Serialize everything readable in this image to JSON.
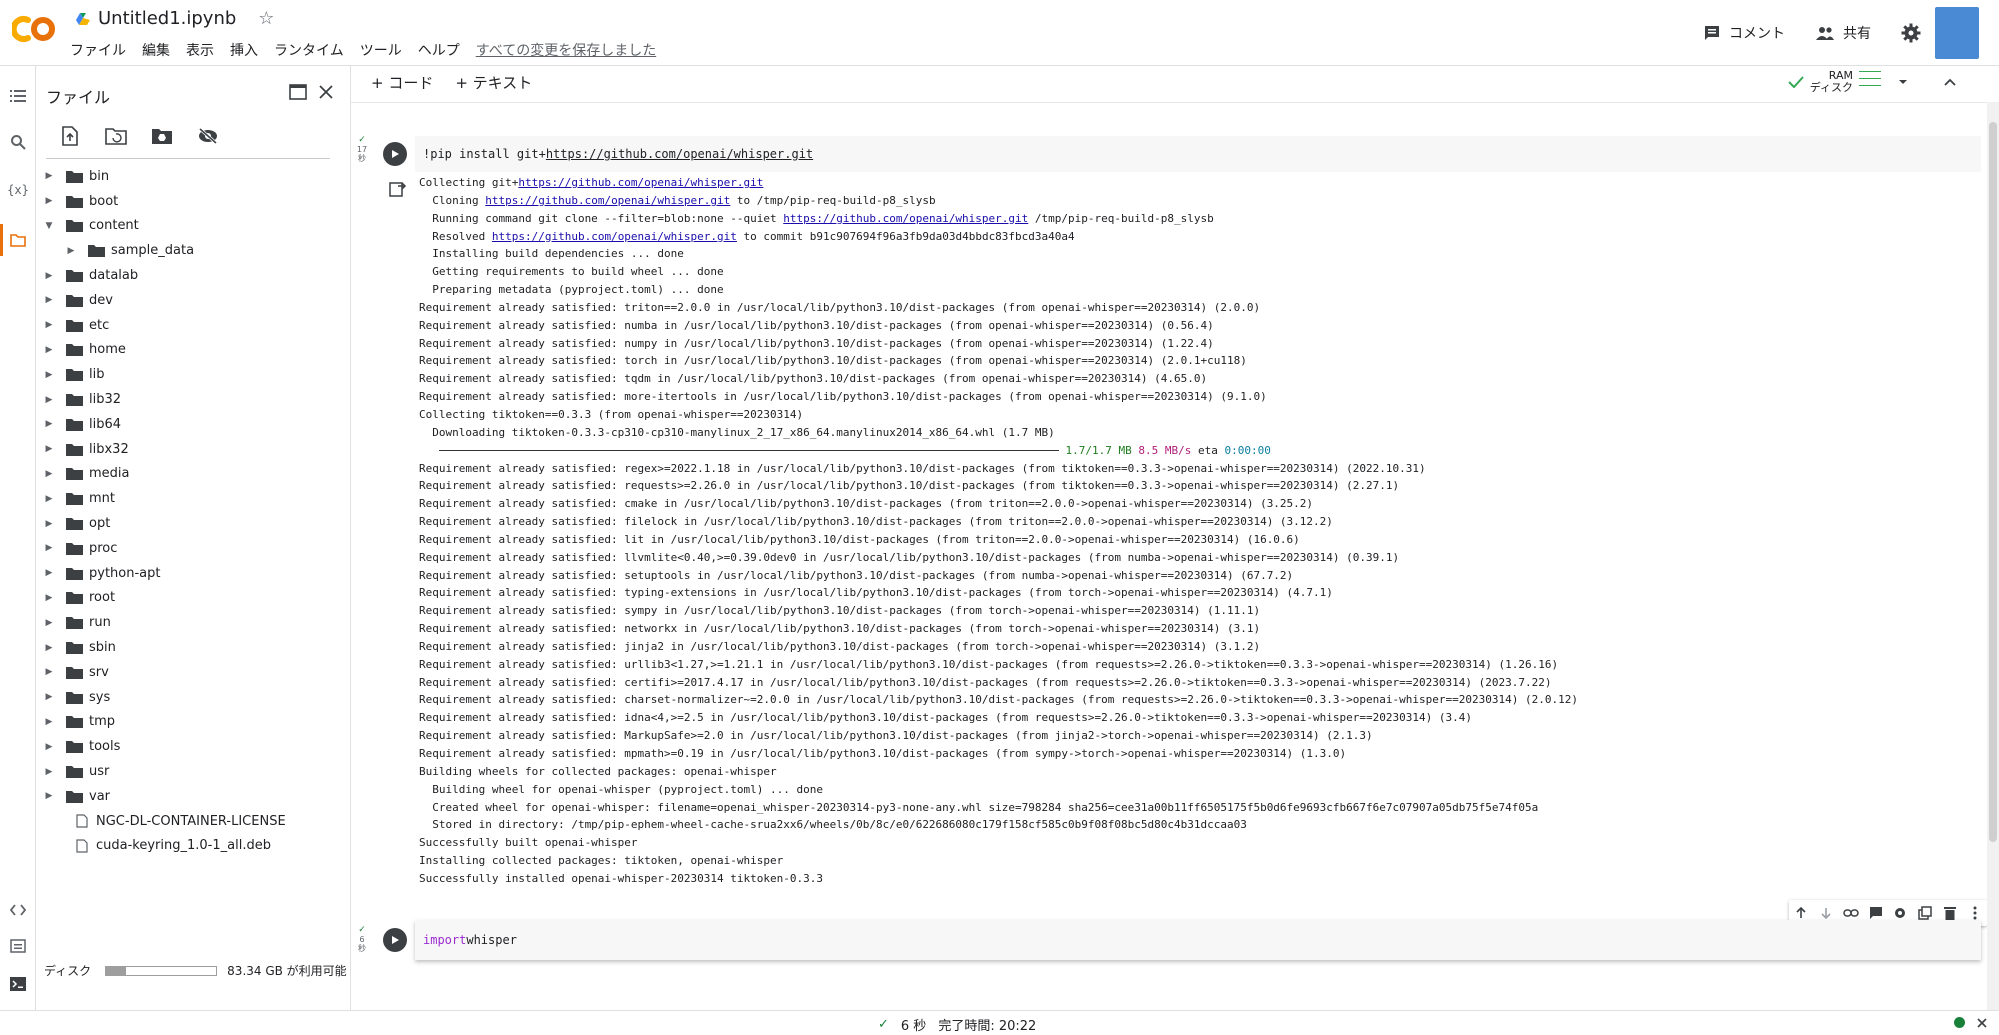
{
  "header": {
    "logo": "CO",
    "notebook_title": "Untitled1.ipynb",
    "star_glyph": "☆",
    "menu": [
      "ファイル",
      "編集",
      "表示",
      "挿入",
      "ランタイム",
      "ツール",
      "ヘルプ"
    ],
    "saved_status": "すべての変更を保存しました",
    "comment_label": "コメント",
    "share_label": "共有"
  },
  "file_panel": {
    "title": "ファイル",
    "tree": [
      {
        "label": "bin",
        "type": "folder",
        "depth": 0,
        "expanded": false
      },
      {
        "label": "boot",
        "type": "folder",
        "depth": 0,
        "expanded": false
      },
      {
        "label": "content",
        "type": "folder",
        "depth": 0,
        "expanded": true
      },
      {
        "label": "sample_data",
        "type": "folder",
        "depth": 1,
        "expanded": false
      },
      {
        "label": "datalab",
        "type": "folder",
        "depth": 0,
        "expanded": false
      },
      {
        "label": "dev",
        "type": "folder",
        "depth": 0,
        "expanded": false
      },
      {
        "label": "etc",
        "type": "folder",
        "depth": 0,
        "expanded": false
      },
      {
        "label": "home",
        "type": "folder",
        "depth": 0,
        "expanded": false
      },
      {
        "label": "lib",
        "type": "folder",
        "depth": 0,
        "expanded": false
      },
      {
        "label": "lib32",
        "type": "folder",
        "depth": 0,
        "expanded": false
      },
      {
        "label": "lib64",
        "type": "folder",
        "depth": 0,
        "expanded": false
      },
      {
        "label": "libx32",
        "type": "folder",
        "depth": 0,
        "expanded": false
      },
      {
        "label": "media",
        "type": "folder",
        "depth": 0,
        "expanded": false
      },
      {
        "label": "mnt",
        "type": "folder",
        "depth": 0,
        "expanded": false
      },
      {
        "label": "opt",
        "type": "folder",
        "depth": 0,
        "expanded": false
      },
      {
        "label": "proc",
        "type": "folder",
        "depth": 0,
        "expanded": false
      },
      {
        "label": "python-apt",
        "type": "folder",
        "depth": 0,
        "expanded": false
      },
      {
        "label": "root",
        "type": "folder",
        "depth": 0,
        "expanded": false
      },
      {
        "label": "run",
        "type": "folder",
        "depth": 0,
        "expanded": false
      },
      {
        "label": "sbin",
        "type": "folder",
        "depth": 0,
        "expanded": false
      },
      {
        "label": "srv",
        "type": "folder",
        "depth": 0,
        "expanded": false
      },
      {
        "label": "sys",
        "type": "folder",
        "depth": 0,
        "expanded": false
      },
      {
        "label": "tmp",
        "type": "folder",
        "depth": 0,
        "expanded": false
      },
      {
        "label": "tools",
        "type": "folder",
        "depth": 0,
        "expanded": false
      },
      {
        "label": "usr",
        "type": "folder",
        "depth": 0,
        "expanded": false
      },
      {
        "label": "var",
        "type": "folder",
        "depth": 0,
        "expanded": false
      },
      {
        "label": "NGC-DL-CONTAINER-LICENSE",
        "type": "file",
        "depth": 0
      },
      {
        "label": "cuda-keyring_1.0-1_all.deb",
        "type": "file",
        "depth": 0
      }
    ],
    "disk_label": "ディスク",
    "disk_usage_fraction": 0.18,
    "disk_free": "83.34 GB が利用可能"
  },
  "toolbar": {
    "add_code": "+ コード",
    "add_text": "+ テキスト",
    "ram_label": "RAM",
    "disk_label": "ディスク"
  },
  "cell1": {
    "exec_check": "✓",
    "exec_time": "17",
    "exec_unit": "秒",
    "code_prefix": "!pip install git+",
    "code_url": "https://github.com/openai/whisper.git",
    "output_lines": [
      [
        {
          "t": "Collecting git+"
        },
        {
          "t": "https://github.com/openai/whisper.git",
          "c": "lk"
        }
      ],
      [
        {
          "t": "  Cloning "
        },
        {
          "t": "https://github.com/openai/whisper.git",
          "c": "lk"
        },
        {
          "t": " to /tmp/pip-req-build-p8_slysb"
        }
      ],
      [
        {
          "t": "  Running command git clone --filter=blob:none --quiet "
        },
        {
          "t": "https://github.com/openai/whisper.git",
          "c": "lk"
        },
        {
          "t": " /tmp/pip-req-build-p8_slysb"
        }
      ],
      [
        {
          "t": "  Resolved "
        },
        {
          "t": "https://github.com/openai/whisper.git",
          "c": "lk"
        },
        {
          "t": " to commit b91c907694f96a3fb9da03d4bbdc83fbcd3a40a4"
        }
      ],
      [
        {
          "t": "  Installing build dependencies ... done"
        }
      ],
      [
        {
          "t": "  Getting requirements to build wheel ... done"
        }
      ],
      [
        {
          "t": "  Preparing metadata (pyproject.toml) ... done"
        }
      ],
      [
        {
          "t": "Requirement already satisfied: triton==2.0.0 in /usr/local/lib/python3.10/dist-packages (from openai-whisper==20230314) (2.0.0)"
        }
      ],
      [
        {
          "t": "Requirement already satisfied: numba in /usr/local/lib/python3.10/dist-packages (from openai-whisper==20230314) (0.56.4)"
        }
      ],
      [
        {
          "t": "Requirement already satisfied: numpy in /usr/local/lib/python3.10/dist-packages (from openai-whisper==20230314) (1.22.4)"
        }
      ],
      [
        {
          "t": "Requirement already satisfied: torch in /usr/local/lib/python3.10/dist-packages (from openai-whisper==20230314) (2.0.1+cu118)"
        }
      ],
      [
        {
          "t": "Requirement already satisfied: tqdm in /usr/local/lib/python3.10/dist-packages (from openai-whisper==20230314) (4.65.0)"
        }
      ],
      [
        {
          "t": "Requirement already satisfied: more-itertools in /usr/local/lib/python3.10/dist-packages (from openai-whisper==20230314) (9.1.0)"
        }
      ],
      [
        {
          "t": "Collecting tiktoken==0.3.3 (from openai-whisper==20230314)"
        }
      ],
      [
        {
          "t": "  Downloading tiktoken-0.3.3-cp310-cp310-manylinux_2_17_x86_64.manylinux2014_x86_64.whl (1.7 MB)"
        }
      ],
      [
        {
          "t": "  ",
          "c": "bar"
        },
        {
          "t": " 1.7/1.7 MB",
          "c": "prog"
        },
        {
          "t": " 8.5 MB/s",
          "c": "speed"
        },
        {
          "t": " eta "
        },
        {
          "t": "0:00:00",
          "c": "eta"
        }
      ],
      [
        {
          "t": "Requirement already satisfied: regex>=2022.1.18 in /usr/local/lib/python3.10/dist-packages (from tiktoken==0.3.3->openai-whisper==20230314) (2022.10.31)"
        }
      ],
      [
        {
          "t": "Requirement already satisfied: requests>=2.26.0 in /usr/local/lib/python3.10/dist-packages (from tiktoken==0.3.3->openai-whisper==20230314) (2.27.1)"
        }
      ],
      [
        {
          "t": "Requirement already satisfied: cmake in /usr/local/lib/python3.10/dist-packages (from triton==2.0.0->openai-whisper==20230314) (3.25.2)"
        }
      ],
      [
        {
          "t": "Requirement already satisfied: filelock in /usr/local/lib/python3.10/dist-packages (from triton==2.0.0->openai-whisper==20230314) (3.12.2)"
        }
      ],
      [
        {
          "t": "Requirement already satisfied: lit in /usr/local/lib/python3.10/dist-packages (from triton==2.0.0->openai-whisper==20230314) (16.0.6)"
        }
      ],
      [
        {
          "t": "Requirement already satisfied: llvmlite<0.40,>=0.39.0dev0 in /usr/local/lib/python3.10/dist-packages (from numba->openai-whisper==20230314) (0.39.1)"
        }
      ],
      [
        {
          "t": "Requirement already satisfied: setuptools in /usr/local/lib/python3.10/dist-packages (from numba->openai-whisper==20230314) (67.7.2)"
        }
      ],
      [
        {
          "t": "Requirement already satisfied: typing-extensions in /usr/local/lib/python3.10/dist-packages (from torch->openai-whisper==20230314) (4.7.1)"
        }
      ],
      [
        {
          "t": "Requirement already satisfied: sympy in /usr/local/lib/python3.10/dist-packages (from torch->openai-whisper==20230314) (1.11.1)"
        }
      ],
      [
        {
          "t": "Requirement already satisfied: networkx in /usr/local/lib/python3.10/dist-packages (from torch->openai-whisper==20230314) (3.1)"
        }
      ],
      [
        {
          "t": "Requirement already satisfied: jinja2 in /usr/local/lib/python3.10/dist-packages (from torch->openai-whisper==20230314) (3.1.2)"
        }
      ],
      [
        {
          "t": "Requirement already satisfied: urllib3<1.27,>=1.21.1 in /usr/local/lib/python3.10/dist-packages (from requests>=2.26.0->tiktoken==0.3.3->openai-whisper==20230314) (1.26.16)"
        }
      ],
      [
        {
          "t": "Requirement already satisfied: certifi>=2017.4.17 in /usr/local/lib/python3.10/dist-packages (from requests>=2.26.0->tiktoken==0.3.3->openai-whisper==20230314) (2023.7.22)"
        }
      ],
      [
        {
          "t": "Requirement already satisfied: charset-normalizer~=2.0.0 in /usr/local/lib/python3.10/dist-packages (from requests>=2.26.0->tiktoken==0.3.3->openai-whisper==20230314) (2.0.12)"
        }
      ],
      [
        {
          "t": "Requirement already satisfied: idna<4,>=2.5 in /usr/local/lib/python3.10/dist-packages (from requests>=2.26.0->tiktoken==0.3.3->openai-whisper==20230314) (3.4)"
        }
      ],
      [
        {
          "t": "Requirement already satisfied: MarkupSafe>=2.0 in /usr/local/lib/python3.10/dist-packages (from jinja2->torch->openai-whisper==20230314) (2.1.3)"
        }
      ],
      [
        {
          "t": "Requirement already satisfied: mpmath>=0.19 in /usr/local/lib/python3.10/dist-packages (from sympy->torch->openai-whisper==20230314) (1.3.0)"
        }
      ],
      [
        {
          "t": "Building wheels for collected packages: openai-whisper"
        }
      ],
      [
        {
          "t": "  Building wheel for openai-whisper (pyproject.toml) ... done"
        }
      ],
      [
        {
          "t": "  Created wheel for openai-whisper: filename=openai_whisper-20230314-py3-none-any.whl size=798284 sha256=cee31a00b11ff6505175f5b0d6fe9693cfb667f6e7c07907a05db75f5e74f05a"
        }
      ],
      [
        {
          "t": "  Stored in directory: /tmp/pip-ephem-wheel-cache-srua2xx6/wheels/0b/8c/e0/622686080c179f158cf585c0b9f08f08bc5d80c4b31dccaa03"
        }
      ],
      [
        {
          "t": "Successfully built openai-whisper"
        }
      ],
      [
        {
          "t": "Installing collected packages: tiktoken, openai-whisper"
        }
      ],
      [
        {
          "t": "Successfully installed openai-whisper-20230314 tiktoken-0.3.3"
        }
      ]
    ]
  },
  "cell2": {
    "exec_check": "✓",
    "exec_time": "6",
    "exec_unit": "秒",
    "code_keyword": "import",
    "code_rest": " whisper"
  },
  "statusbar": {
    "check": "✓",
    "duration": "6 秒",
    "completed": "完了時間: 20:22"
  },
  "colors": {
    "logo_orange": "#e8710a",
    "logo_yellow": "#f9ab00",
    "accent_green": "#34a853",
    "avatar_blue": "#4a8ad4",
    "keyword_purple": "#9a2cd1",
    "link_blue": "#1a0dab"
  }
}
